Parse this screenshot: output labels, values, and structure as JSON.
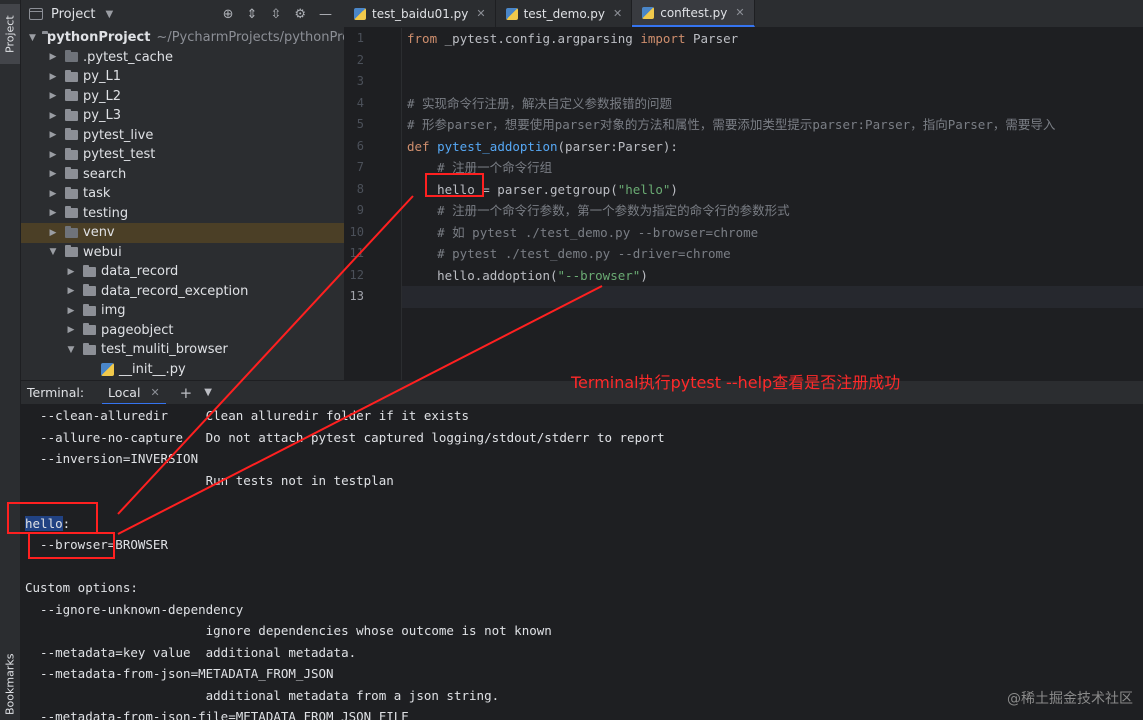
{
  "strip": {
    "project_tab": "Project",
    "bookmarks_tab": "Bookmarks"
  },
  "project_panel": {
    "title": "Project",
    "tree": [
      {
        "label": "pythonProject",
        "sub": "~/PycharmProjects/pythonProje",
        "type": "folder-root",
        "expanded": true,
        "indent": 0
      },
      {
        "label": ".pytest_cache",
        "type": "folder",
        "expanded": false,
        "indent": 1
      },
      {
        "label": "py_L1",
        "type": "folder",
        "expanded": false,
        "indent": 1
      },
      {
        "label": "py_L2",
        "type": "folder",
        "expanded": false,
        "indent": 1
      },
      {
        "label": "py_L3",
        "type": "folder",
        "expanded": false,
        "indent": 1
      },
      {
        "label": "pytest_live",
        "type": "folder",
        "expanded": false,
        "indent": 1
      },
      {
        "label": "pytest_test",
        "type": "folder",
        "expanded": false,
        "indent": 1
      },
      {
        "label": "search",
        "type": "folder",
        "expanded": false,
        "indent": 1
      },
      {
        "label": "task",
        "type": "folder",
        "expanded": false,
        "indent": 1
      },
      {
        "label": "testing",
        "type": "folder",
        "expanded": false,
        "indent": 1
      },
      {
        "label": "venv",
        "type": "folder",
        "expanded": false,
        "indent": 1,
        "selected": true
      },
      {
        "label": "webui",
        "type": "folder",
        "expanded": true,
        "indent": 1
      },
      {
        "label": "data_record",
        "type": "folder",
        "expanded": false,
        "indent": 2
      },
      {
        "label": "data_record_exception",
        "type": "folder",
        "expanded": false,
        "indent": 2
      },
      {
        "label": "img",
        "type": "folder",
        "expanded": false,
        "indent": 2
      },
      {
        "label": "pageobject",
        "type": "folder",
        "expanded": false,
        "indent": 2
      },
      {
        "label": "test_muliti_browser",
        "type": "folder",
        "expanded": true,
        "indent": 2
      },
      {
        "label": "__init__.py",
        "type": "file",
        "indent": 3
      }
    ]
  },
  "tabs": [
    {
      "label": "test_baidu01.py",
      "active": false
    },
    {
      "label": "test_demo.py",
      "active": false
    },
    {
      "label": "conftest.py",
      "active": true
    }
  ],
  "editor": {
    "current_line": 13,
    "lines": [
      [
        {
          "t": "from ",
          "c": "kw"
        },
        {
          "t": "_pytest.config.argparsing ",
          "c": "cls"
        },
        {
          "t": "import ",
          "c": "kw"
        },
        {
          "t": "Parser",
          "c": "cls"
        }
      ],
      [],
      [],
      [
        {
          "t": "# 实现命令行注册，解决自定义参数报错的问题",
          "c": "cmt"
        }
      ],
      [
        {
          "t": "# 形参parser，想要使用parser对象的方法和属性，需要添加类型提示parser:Parser，指向Parser，需要导入",
          "c": "cmt"
        }
      ],
      [
        {
          "t": "def ",
          "c": "kw"
        },
        {
          "t": "pytest_addoption",
          "c": "fn"
        },
        {
          "t": "(parser:Parser):",
          "c": "cls"
        }
      ],
      [
        {
          "t": "    # 注册一个命令行组",
          "c": "cmt"
        }
      ],
      [
        {
          "t": "    hello = parser.getgroup(",
          "c": "cls"
        },
        {
          "t": "\"hello\"",
          "c": "str"
        },
        {
          "t": ")",
          "c": "cls"
        }
      ],
      [
        {
          "t": "    # 注册一个命令行参数，第一个参数为指定的命令行的参数形式",
          "c": "cmt"
        }
      ],
      [
        {
          "t": "    # 如 pytest ./test_demo.py --browser=chrome",
          "c": "cmt"
        }
      ],
      [
        {
          "t": "    # pytest ./test_demo.py --driver=chrome",
          "c": "cmt"
        }
      ],
      [
        {
          "t": "    hello.addoption(",
          "c": "cls"
        },
        {
          "t": "\"--browser\"",
          "c": "str"
        },
        {
          "t": ")",
          "c": "cls"
        }
      ],
      []
    ]
  },
  "terminal": {
    "label": "Terminal:",
    "tab": "Local",
    "lines": [
      "  --clean-alluredir     Clean alluredir folder if it exists",
      "  --allure-no-capture   Do not attach pytest captured logging/stdout/stderr to report",
      "  --inversion=INVERSION",
      "                        Run tests not in testplan",
      "",
      "hello:",
      "  --browser=BROWSER",
      "",
      "Custom options:",
      "  --ignore-unknown-dependency",
      "                        ignore dependencies whose outcome is not known",
      "  --metadata=key value  additional metadata.",
      "  --metadata-from-json=METADATA_FROM_JSON",
      "                        additional metadata from a json string.",
      "  --metadata-from-json-file=METADATA_FROM_JSON_FILE"
    ]
  },
  "annotation": {
    "text": "Terminal执行pytest --help查看是否注册成功",
    "color": "#ff2a2a"
  },
  "watermark": "@稀土掘金技术社区"
}
